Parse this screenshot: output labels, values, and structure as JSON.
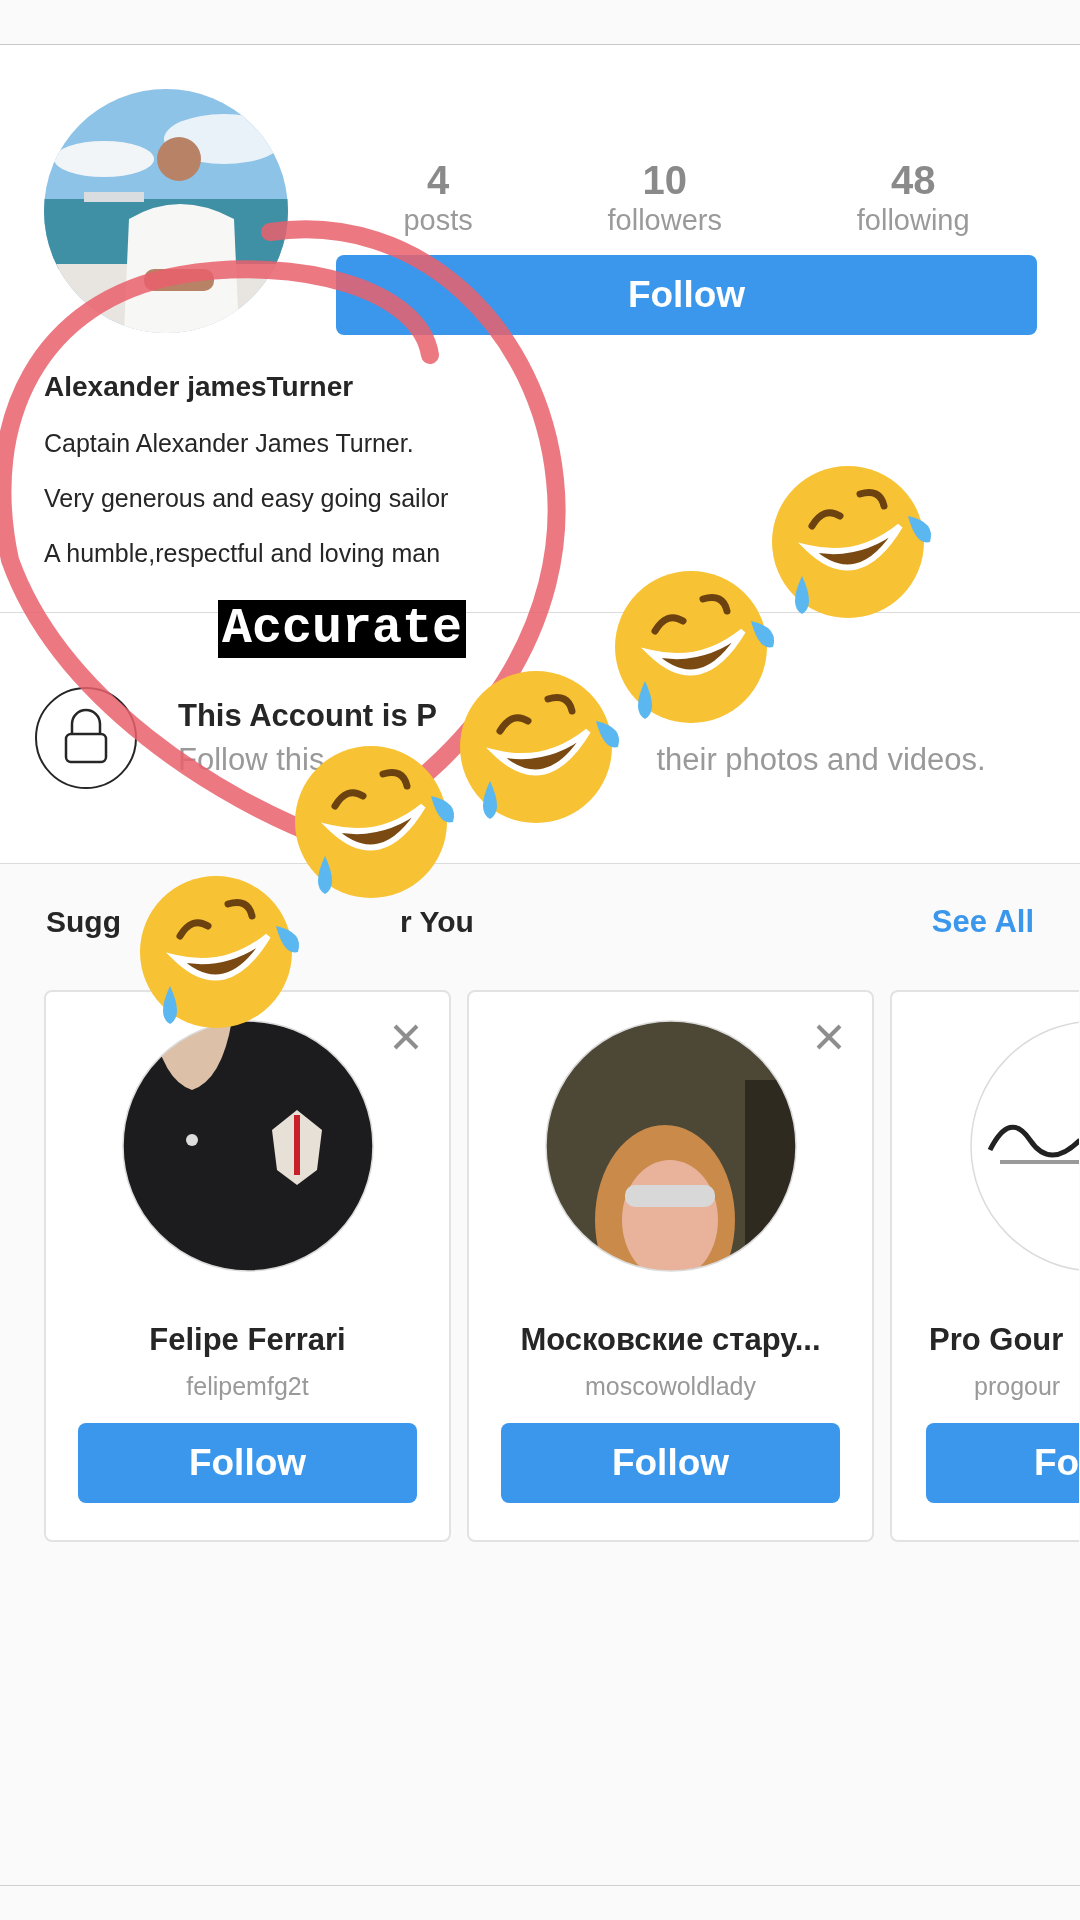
{
  "profile": {
    "stats": [
      {
        "value": "4",
        "label": "posts"
      },
      {
        "value": "10",
        "label": "followers"
      },
      {
        "value": "48",
        "label": "following"
      }
    ],
    "follow_button": "Follow",
    "name": "Alexander jamesTurner",
    "bio": [
      "Captain Alexander James Turner.",
      "Very generous and easy going sailor",
      "A humble,respectful and loving man"
    ]
  },
  "sticker": {
    "label": "Accurate"
  },
  "private_notice": {
    "title": "This Account is P",
    "subtitle_parts": [
      "Follow this",
      "their photos and videos."
    ]
  },
  "suggestions": {
    "title_parts": [
      "Sugg",
      "r You"
    ],
    "see_all": "See All",
    "cards": [
      {
        "name": "Felipe Ferrari",
        "username": "felipemfg2t",
        "button": "Follow",
        "clipped": false
      },
      {
        "name": "Московские стару...",
        "username": "moscowoldlady",
        "button": "Follow",
        "clipped": false
      },
      {
        "name": "Pro Gour",
        "username": "progour",
        "button": "Fo",
        "clipped": true
      }
    ]
  }
}
